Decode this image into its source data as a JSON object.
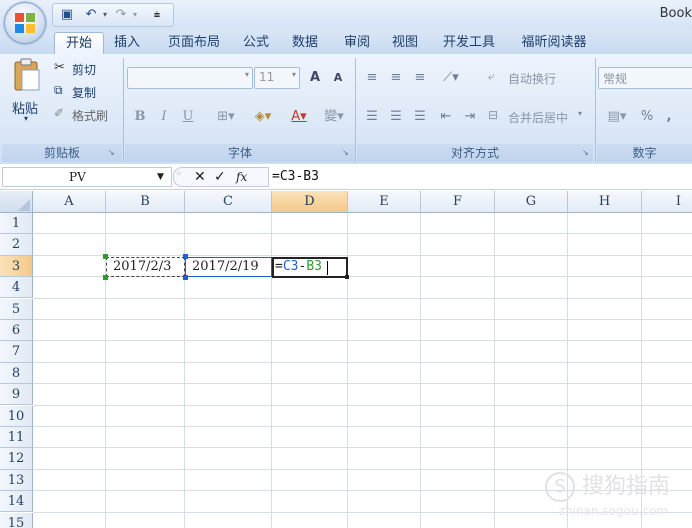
{
  "window": {
    "title": "Book"
  },
  "quick_access": {
    "icons": [
      "save-icon",
      "undo-icon",
      "redo-icon",
      "customize-icon"
    ]
  },
  "tabs": [
    "开始",
    "插入",
    "页面布局",
    "公式",
    "数据",
    "审阅",
    "视图",
    "开发工具",
    "福昕阅读器"
  ],
  "ribbon": {
    "clipboard": {
      "paste": "粘贴",
      "cut": "剪切",
      "copy": "复制",
      "format_painter": "格式刷",
      "label": "剪贴板"
    },
    "font": {
      "font_name": "",
      "font_size": "11",
      "bold": "B",
      "italic": "I",
      "underline": "U",
      "label": "字体",
      "grow": "A",
      "shrink": "A",
      "pinyin": "變"
    },
    "alignment": {
      "wrap_text": "自动换行",
      "merge_center": "合并后居中",
      "label": "对齐方式"
    },
    "number": {
      "format": "常规",
      "percent": "%",
      "comma": ",",
      "label": "数字"
    }
  },
  "formula_bar": {
    "name_box": "PV",
    "cancel": "✕",
    "enter": "✓",
    "fx": "fx",
    "formula": "=C3-B3"
  },
  "grid": {
    "columns": [
      "A",
      "B",
      "C",
      "D",
      "E",
      "F",
      "G",
      "H",
      "I"
    ],
    "rows": [
      "1",
      "2",
      "3",
      "4",
      "5",
      "6",
      "7",
      "8",
      "9",
      "10",
      "11",
      "12",
      "13",
      "14",
      "15"
    ],
    "active_column": "D",
    "active_row": "3",
    "cells": {
      "B3": "2017/2/3",
      "C3": "2017/2/19",
      "D3_eq": "=",
      "D3_ref1": "C3",
      "D3_op": "-",
      "D3_ref2": "B3"
    }
  },
  "watermark": {
    "brand": "搜狗指南",
    "url": "zhinan.sogou.com"
  },
  "colors": {
    "ref_blue": "#1f5fcf",
    "ref_green": "#2f9a2f",
    "accent": "#f4c98a"
  }
}
